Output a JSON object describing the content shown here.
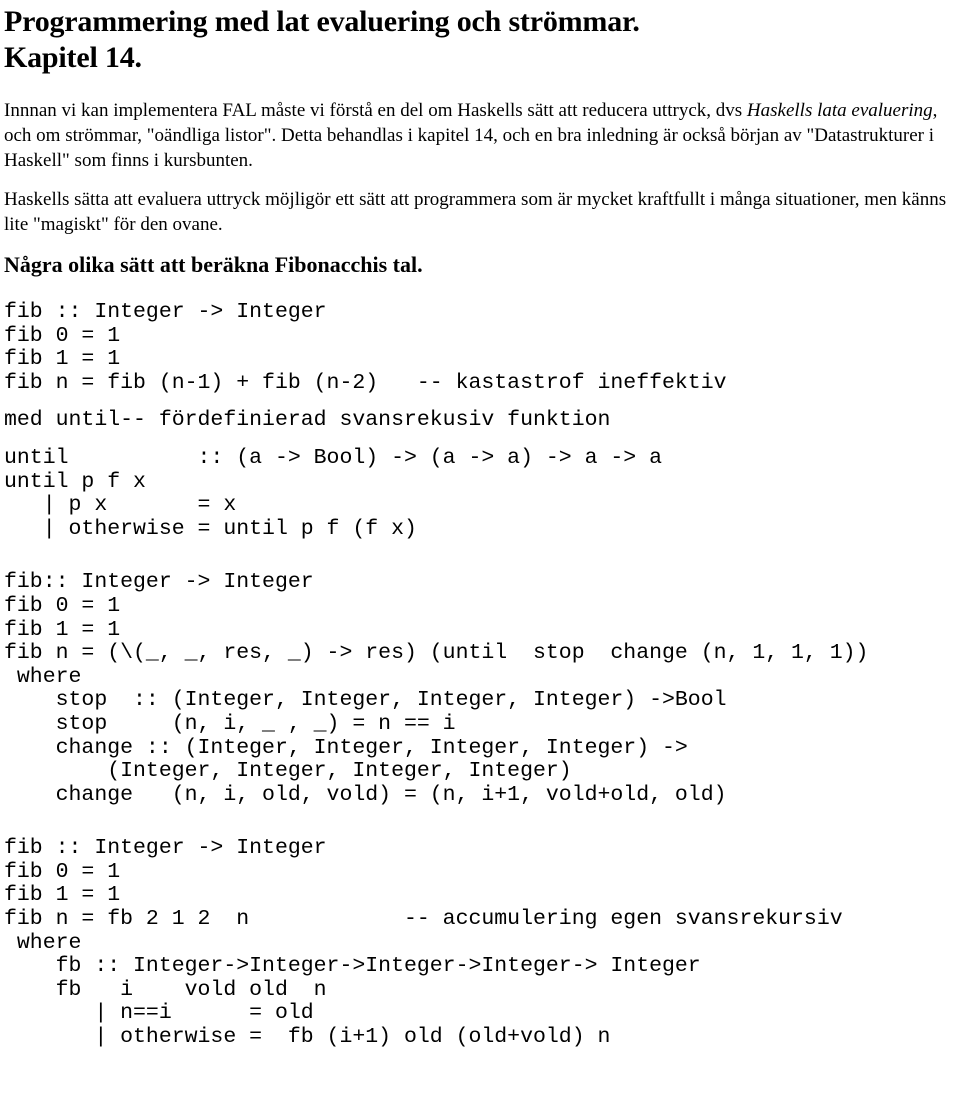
{
  "document": {
    "title_line1": "Programmering med lat evaluering och strömmar.",
    "title_line2": "Kapitel 14.",
    "intro_paragraph": "Innnan vi kan implementera FAL måste vi förstå en del om Haskells sätt att reducera uttryck, dvs ",
    "intro_emphasis": "Haskells lata evaluering",
    "intro_paragraph_rest": ", och om strömmar, \"oändliga listor\". Detta behandlas i kapitel 14, och en bra inledning är också början av \"Datastrukturer i Haskell\" som finns i kursbunten.",
    "second_paragraph": "Haskells sätta att evaluera uttryck möjligör ett sätt att programmera som är mycket kraftfullt i många situationer, men känns lite \"magiskt\" för den ovane.",
    "section_heading": "Några olika sätt att beräkna Fibonacchis tal.",
    "code_block_1": "fib :: Integer -> Integer\nfib 0 = 1\nfib 1 = 1\nfib n = fib (n-1) + fib (n-2)   -- kastastrof ineffektiv",
    "code_block_2": "med until-- fördefinierad svansrekusiv funktion",
    "code_block_3": "until          :: (a -> Bool) -> (a -> a) -> a -> a\nuntil p f x\n   | p x       = x\n   | otherwise = until p f (f x)",
    "code_block_4": "fib:: Integer -> Integer\nfib 0 = 1\nfib 1 = 1\nfib n = (\\(_, _, res, _) -> res) (until  stop  change (n, 1, 1, 1))\n where\n    stop  :: (Integer, Integer, Integer, Integer) ->Bool\n    stop     (n, i, _ , _) = n == i\n    change :: (Integer, Integer, Integer, Integer) ->\n        (Integer, Integer, Integer, Integer)\n    change   (n, i, old, vold) = (n, i+1, vold+old, old)",
    "code_block_5": "fib :: Integer -> Integer\nfib 0 = 1\nfib 1 = 1\nfib n = fb 2 1 2  n            -- accumulering egen svansrekursiv\n where\n    fb :: Integer->Integer->Integer->Integer-> Integer\n    fb   i    vold old  n\n       | n==i      = old\n       | otherwise =  fb (i+1) old (old+vold) n"
  }
}
